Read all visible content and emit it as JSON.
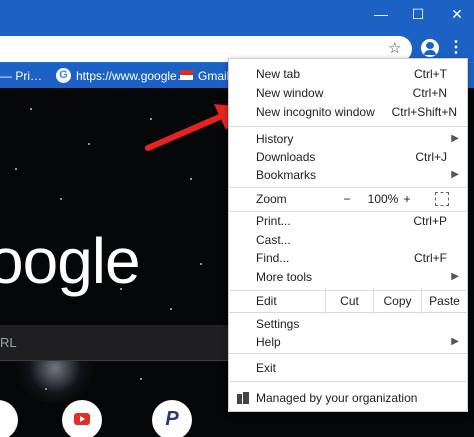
{
  "window_controls": {
    "minimize": "—",
    "maximize": "☐",
    "close": "✕"
  },
  "toolbar": {
    "star": "☆",
    "menu_dots": "⋮"
  },
  "bookmarks": [
    {
      "label": "— Pri…",
      "icon": "bookmark-icon"
    },
    {
      "label": "https://www.google…",
      "icon": "google-icon"
    },
    {
      "label": "Gmail",
      "icon": "gmail-icon"
    }
  ],
  "page": {
    "logo_text": "oogle",
    "search_placeholder": "RL"
  },
  "menu": {
    "new_tab": {
      "label": "New tab",
      "shortcut": "Ctrl+T"
    },
    "new_window": {
      "label": "New window",
      "shortcut": "Ctrl+N"
    },
    "new_incognito": {
      "label": "New incognito window",
      "shortcut": "Ctrl+Shift+N"
    },
    "history": {
      "label": "History"
    },
    "downloads": {
      "label": "Downloads",
      "shortcut": "Ctrl+J"
    },
    "bookmarks": {
      "label": "Bookmarks"
    },
    "zoom": {
      "label": "Zoom",
      "minus": "−",
      "value": "100%",
      "plus": "+"
    },
    "print": {
      "label": "Print...",
      "shortcut": "Ctrl+P"
    },
    "cast": {
      "label": "Cast..."
    },
    "find": {
      "label": "Find...",
      "shortcut": "Ctrl+F"
    },
    "more_tools": {
      "label": "More tools"
    },
    "edit": {
      "label": "Edit",
      "cut": "Cut",
      "copy": "Copy",
      "paste": "Paste"
    },
    "settings": {
      "label": "Settings"
    },
    "help": {
      "label": "Help"
    },
    "exit": {
      "label": "Exit"
    },
    "managed": {
      "label": "Managed by your organization"
    }
  },
  "colors": {
    "titlebar": "#1b62c4",
    "arrow": "#e8231f"
  }
}
